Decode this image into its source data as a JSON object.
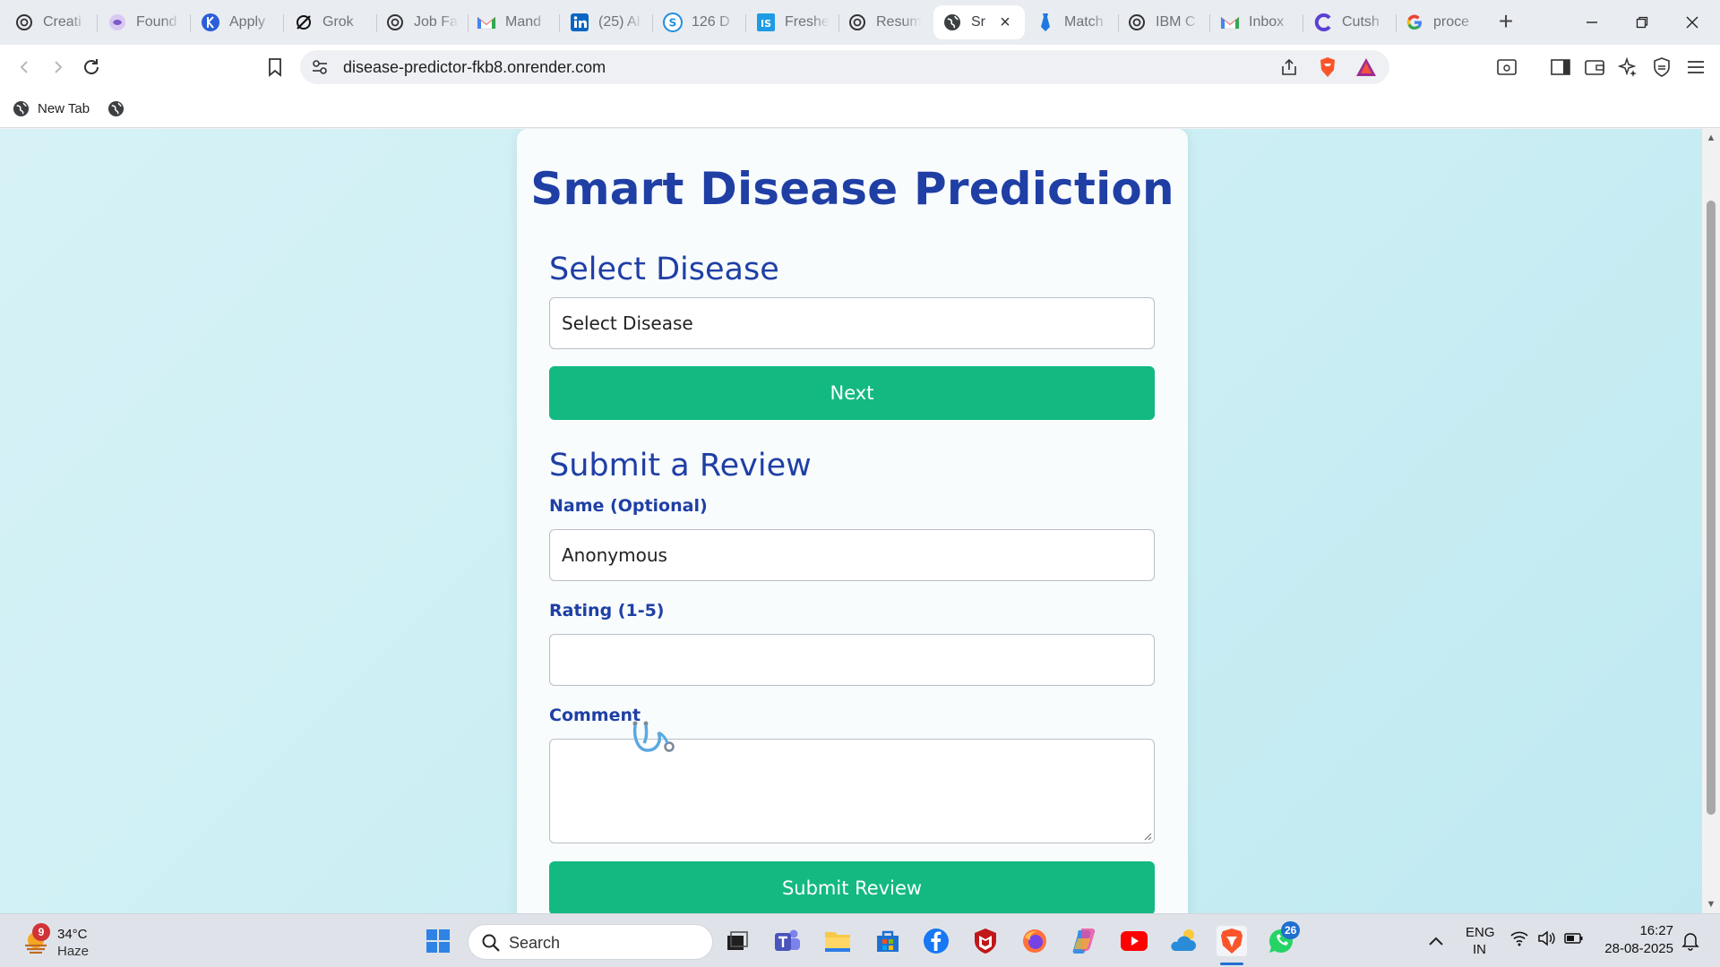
{
  "browser": {
    "tabs": [
      {
        "title": "Creati",
        "icon": "openai-icon",
        "active": false
      },
      {
        "title": "Found",
        "icon": "perplexity-icon",
        "active": false
      },
      {
        "title": "Apply",
        "icon": "k-logo-icon",
        "active": false
      },
      {
        "title": "Grok",
        "icon": "grok-icon",
        "active": false
      },
      {
        "title": "Job Fa",
        "icon": "openai-icon",
        "active": false
      },
      {
        "title": "Mand",
        "icon": "gmail-icon",
        "active": false
      },
      {
        "title": "(25) Al",
        "icon": "linkedin-icon",
        "active": false
      },
      {
        "title": "126 D",
        "icon": "s-logo-icon",
        "active": false
      },
      {
        "title": "Freshe",
        "icon": "is-logo-icon",
        "active": false
      },
      {
        "title": "Resum",
        "icon": "openai-icon",
        "active": false
      },
      {
        "title": "Sr",
        "icon": "globe-icon",
        "active": true
      },
      {
        "title": "Match",
        "icon": "tie-icon",
        "active": false
      },
      {
        "title": "IBM C",
        "icon": "openai-icon",
        "active": false
      },
      {
        "title": "Inbox",
        "icon": "gmail-icon",
        "active": false
      },
      {
        "title": "Cutsh",
        "icon": "c-logo-icon",
        "active": false
      },
      {
        "title": "proce",
        "icon": "google-icon",
        "active": false
      }
    ],
    "url": "disease-predictor-fkb8.onrender.com",
    "bookmarks": [
      {
        "label": "New Tab",
        "icon": "globe-icon"
      },
      {
        "label": "",
        "icon": "globe-icon"
      }
    ],
    "colors": {
      "brave": "#fb542b",
      "accent": "#1f3fa5",
      "button": "#13b981"
    }
  },
  "page": {
    "title": "Smart Disease Prediction",
    "select_heading": "Select Disease",
    "select_value": "Select Disease",
    "next_label": "Next",
    "review_heading": "Submit a Review",
    "name_label": "Name (Optional)",
    "name_value": "Anonymous",
    "rating_label": "Rating (1-5)",
    "rating_value": "",
    "comment_label": "Comment",
    "comment_value": "",
    "submit_label": "Submit Review"
  },
  "taskbar": {
    "weather": {
      "temp": "34°C",
      "condition": "Haze",
      "badge": "9"
    },
    "search_placeholder": "Search",
    "whatsapp_badge": "26",
    "language": {
      "line1": "ENG",
      "line2": "IN"
    },
    "time": "16:27",
    "date": "28-08-2025"
  }
}
